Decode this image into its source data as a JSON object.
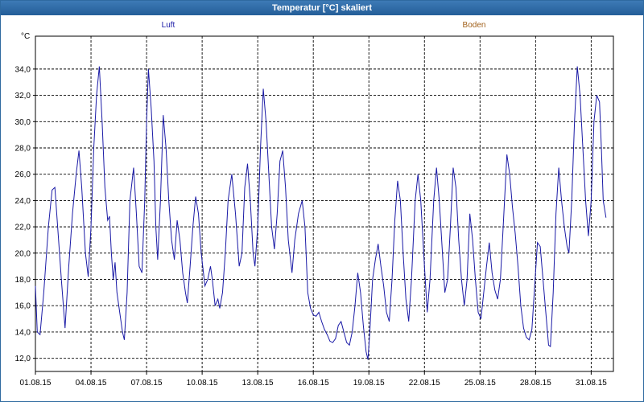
{
  "window": {
    "title": "Temperatur [°C] skaliert"
  },
  "chart_data": {
    "type": "line",
    "title": "Temperatur [°C] skaliert",
    "ylabel": "°C",
    "xlabel": "",
    "ylim": [
      11.0,
      36.5
    ],
    "y_ticks": [
      12.0,
      14.0,
      16.0,
      18.0,
      20.0,
      22.0,
      24.0,
      26.0,
      28.0,
      30.0,
      32.0,
      34.0
    ],
    "y_tick_labels": [
      "12,0",
      "14,0",
      "16,0",
      "18,0",
      "20,0",
      "22,0",
      "24,0",
      "26,0",
      "28,0",
      "30,0",
      "32,0",
      "34,0"
    ],
    "x_range_days": [
      1,
      32.2
    ],
    "x_ticks": [
      1,
      4,
      7,
      10,
      13,
      16,
      19,
      22,
      25,
      28,
      31
    ],
    "x_tick_labels": [
      "01.08.15",
      "04.08.15",
      "07.08.15",
      "10.08.15",
      "13.08.15",
      "16.08.15",
      "19.08.15",
      "22.08.15",
      "25.08.15",
      "28.08.15",
      "31.08.15"
    ],
    "grid": true,
    "legend": [
      {
        "name": "Luft",
        "color": "#1a1aa6"
      },
      {
        "name": "Boden",
        "color": "#a0601a"
      }
    ],
    "series": [
      {
        "name": "Luft",
        "color": "#1a1aa6",
        "points": [
          [
            1.0,
            17.5
          ],
          [
            1.1,
            14.0
          ],
          [
            1.25,
            13.8
          ],
          [
            1.45,
            17.0
          ],
          [
            1.7,
            22.0
          ],
          [
            1.9,
            24.8
          ],
          [
            2.05,
            25.0
          ],
          [
            2.2,
            22.0
          ],
          [
            2.4,
            18.0
          ],
          [
            2.6,
            14.3
          ],
          [
            2.8,
            19.0
          ],
          [
            3.0,
            23.0
          ],
          [
            3.2,
            26.0
          ],
          [
            3.35,
            27.8
          ],
          [
            3.5,
            25.0
          ],
          [
            3.7,
            20.0
          ],
          [
            3.85,
            18.2
          ],
          [
            4.0,
            22.0
          ],
          [
            4.15,
            28.0
          ],
          [
            4.3,
            32.0
          ],
          [
            4.45,
            34.2
          ],
          [
            4.6,
            30.0
          ],
          [
            4.75,
            25.0
          ],
          [
            4.9,
            22.5
          ],
          [
            5.0,
            22.8
          ],
          [
            5.1,
            20.0
          ],
          [
            5.2,
            18.0
          ],
          [
            5.3,
            19.3
          ],
          [
            5.4,
            17.0
          ],
          [
            5.55,
            15.5
          ],
          [
            5.7,
            14.0
          ],
          [
            5.8,
            13.4
          ],
          [
            5.95,
            17.0
          ],
          [
            6.1,
            24.0
          ],
          [
            6.3,
            26.5
          ],
          [
            6.45,
            23.0
          ],
          [
            6.6,
            19.0
          ],
          [
            6.75,
            18.5
          ],
          [
            6.9,
            24.0
          ],
          [
            7.0,
            30.0
          ],
          [
            7.1,
            34.0
          ],
          [
            7.25,
            31.0
          ],
          [
            7.4,
            27.0
          ],
          [
            7.5,
            22.0
          ],
          [
            7.6,
            19.5
          ],
          [
            7.75,
            24.0
          ],
          [
            7.9,
            30.5
          ],
          [
            8.05,
            28.0
          ],
          [
            8.2,
            24.0
          ],
          [
            8.35,
            21.0
          ],
          [
            8.5,
            19.5
          ],
          [
            8.65,
            22.5
          ],
          [
            8.8,
            21.0
          ],
          [
            8.95,
            18.5
          ],
          [
            9.1,
            17.0
          ],
          [
            9.2,
            16.2
          ],
          [
            9.35,
            19.0
          ],
          [
            9.5,
            22.0
          ],
          [
            9.65,
            24.3
          ],
          [
            9.8,
            23.0
          ],
          [
            9.95,
            20.0
          ],
          [
            10.15,
            17.5
          ],
          [
            10.3,
            18.0
          ],
          [
            10.45,
            19.0
          ],
          [
            10.55,
            18.0
          ],
          [
            10.7,
            16.0
          ],
          [
            10.85,
            16.5
          ],
          [
            10.95,
            15.8
          ],
          [
            11.1,
            17.0
          ],
          [
            11.25,
            20.0
          ],
          [
            11.4,
            24.0
          ],
          [
            11.6,
            26.0
          ],
          [
            11.8,
            23.0
          ],
          [
            12.0,
            19.0
          ],
          [
            12.15,
            20.0
          ],
          [
            12.3,
            25.0
          ],
          [
            12.45,
            26.8
          ],
          [
            12.6,
            24.0
          ],
          [
            12.75,
            20.0
          ],
          [
            12.85,
            19.0
          ],
          [
            13.0,
            22.0
          ],
          [
            13.15,
            28.0
          ],
          [
            13.3,
            32.5
          ],
          [
            13.45,
            30.0
          ],
          [
            13.6,
            26.0
          ],
          [
            13.75,
            22.0
          ],
          [
            13.9,
            20.3
          ],
          [
            14.05,
            23.0
          ],
          [
            14.2,
            27.0
          ],
          [
            14.35,
            27.8
          ],
          [
            14.5,
            25.0
          ],
          [
            14.65,
            21.0
          ],
          [
            14.85,
            18.5
          ],
          [
            15.0,
            21.0
          ],
          [
            15.2,
            23.0
          ],
          [
            15.4,
            24.0
          ],
          [
            15.55,
            22.0
          ],
          [
            15.7,
            17.0
          ],
          [
            15.85,
            15.8
          ],
          [
            16.0,
            15.3
          ],
          [
            16.15,
            15.2
          ],
          [
            16.3,
            15.5
          ],
          [
            16.45,
            14.8
          ],
          [
            16.6,
            14.2
          ],
          [
            16.75,
            13.8
          ],
          [
            16.9,
            13.3
          ],
          [
            17.05,
            13.2
          ],
          [
            17.2,
            13.5
          ],
          [
            17.35,
            14.5
          ],
          [
            17.5,
            14.8
          ],
          [
            17.65,
            14.0
          ],
          [
            17.8,
            13.2
          ],
          [
            17.95,
            13.0
          ],
          [
            18.1,
            14.0
          ],
          [
            18.25,
            16.0
          ],
          [
            18.4,
            18.5
          ],
          [
            18.55,
            17.0
          ],
          [
            18.7,
            14.5
          ],
          [
            18.85,
            12.5
          ],
          [
            18.95,
            11.9
          ],
          [
            19.05,
            14.0
          ],
          [
            19.2,
            18.0
          ],
          [
            19.35,
            19.5
          ],
          [
            19.5,
            20.7
          ],
          [
            19.65,
            19.0
          ],
          [
            19.8,
            17.5
          ],
          [
            19.95,
            15.5
          ],
          [
            20.1,
            14.8
          ],
          [
            20.25,
            18.0
          ],
          [
            20.4,
            22.5
          ],
          [
            20.55,
            25.5
          ],
          [
            20.7,
            24.0
          ],
          [
            20.85,
            20.0
          ],
          [
            21.0,
            16.5
          ],
          [
            21.15,
            14.8
          ],
          [
            21.3,
            18.0
          ],
          [
            21.5,
            24.0
          ],
          [
            21.65,
            26.0
          ],
          [
            21.8,
            24.0
          ],
          [
            22.0,
            19.0
          ],
          [
            22.15,
            15.5
          ],
          [
            22.3,
            18.0
          ],
          [
            22.5,
            24.0
          ],
          [
            22.65,
            26.5
          ],
          [
            22.8,
            24.0
          ],
          [
            22.95,
            20.5
          ],
          [
            23.1,
            17.0
          ],
          [
            23.25,
            18.0
          ],
          [
            23.4,
            22.0
          ],
          [
            23.55,
            26.5
          ],
          [
            23.7,
            25.0
          ],
          [
            23.85,
            21.0
          ],
          [
            24.0,
            18.0
          ],
          [
            24.15,
            16.0
          ],
          [
            24.3,
            18.0
          ],
          [
            24.45,
            23.0
          ],
          [
            24.6,
            21.0
          ],
          [
            24.75,
            18.0
          ],
          [
            24.9,
            15.5
          ],
          [
            25.05,
            15.0
          ],
          [
            25.2,
            17.0
          ],
          [
            25.35,
            19.0
          ],
          [
            25.5,
            20.8
          ],
          [
            25.65,
            18.5
          ],
          [
            25.8,
            17.2
          ],
          [
            25.95,
            16.5
          ],
          [
            26.1,
            18.0
          ],
          [
            26.25,
            22.0
          ],
          [
            26.45,
            27.5
          ],
          [
            26.6,
            26.0
          ],
          [
            26.75,
            23.5
          ],
          [
            26.9,
            21.5
          ],
          [
            27.05,
            19.0
          ],
          [
            27.2,
            16.0
          ],
          [
            27.35,
            14.3
          ],
          [
            27.5,
            13.6
          ],
          [
            27.65,
            13.4
          ],
          [
            27.8,
            14.2
          ],
          [
            27.95,
            17.5
          ],
          [
            28.1,
            20.8
          ],
          [
            28.25,
            20.5
          ],
          [
            28.4,
            18.0
          ],
          [
            28.55,
            15.5
          ],
          [
            28.7,
            13.0
          ],
          [
            28.8,
            12.9
          ],
          [
            28.95,
            17.0
          ],
          [
            29.1,
            23.0
          ],
          [
            29.25,
            26.5
          ],
          [
            29.4,
            24.0
          ],
          [
            29.55,
            22.0
          ],
          [
            29.7,
            20.5
          ],
          [
            29.8,
            20.0
          ],
          [
            29.95,
            24.0
          ],
          [
            30.1,
            30.0
          ],
          [
            30.25,
            34.2
          ],
          [
            30.4,
            32.0
          ],
          [
            30.55,
            28.0
          ],
          [
            30.7,
            24.0
          ],
          [
            30.85,
            21.3
          ],
          [
            31.0,
            24.0
          ],
          [
            31.15,
            30.0
          ],
          [
            31.3,
            32.0
          ],
          [
            31.45,
            31.5
          ],
          [
            31.55,
            28.0
          ],
          [
            31.65,
            24.0
          ],
          [
            31.8,
            22.7
          ]
        ]
      }
    ]
  }
}
